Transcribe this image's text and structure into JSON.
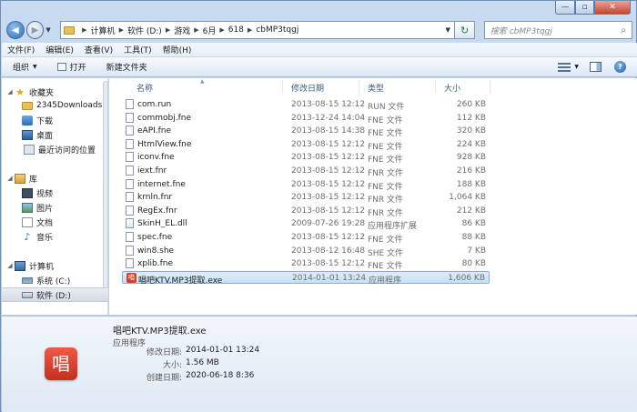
{
  "window": {
    "controls": {
      "minimize": "—",
      "maximize": "▫",
      "close": "✕"
    }
  },
  "nav": {
    "back_icon": "◀",
    "forward_icon": "▶",
    "recent_icon": "▼",
    "breadcrumb": [
      "计算机",
      "软件 (D:)",
      "游戏",
      "6月",
      "618",
      "cbMP3tqgj"
    ],
    "breadcrumb_sep": "▶",
    "dropdown_icon": "▼",
    "refresh_icon": "↻",
    "search_placeholder": "搜索 cbMP3tqgj",
    "search_icon": "⌕"
  },
  "menubar": [
    "文件(F)",
    "编辑(E)",
    "查看(V)",
    "工具(T)",
    "帮助(H)"
  ],
  "toolbar": {
    "organize": "组织",
    "organize_arrow": "▼",
    "open": "打开",
    "new_folder": "新建文件夹",
    "view_arrow": "▼",
    "help": "?"
  },
  "navpane": {
    "items": [
      {
        "label": "收藏夹",
        "icon": "star-icon",
        "glyph": "★",
        "level": 0,
        "expanded": true
      },
      {
        "label": "2345Downloads",
        "icon": "folder-icon",
        "level": 1
      },
      {
        "label": "下载",
        "icon": "download-folder-icon",
        "level": 1
      },
      {
        "label": "桌面",
        "icon": "desktop-icon",
        "level": 1
      },
      {
        "label": "最近访问的位置",
        "icon": "recent-places-icon",
        "level": 1
      },
      {
        "label": "库",
        "icon": "library-icon",
        "level": 0,
        "expanded": true
      },
      {
        "label": "视频",
        "icon": "video-library-icon",
        "level": 1
      },
      {
        "label": "图片",
        "icon": "pictures-library-icon",
        "level": 1
      },
      {
        "label": "文档",
        "icon": "documents-library-icon",
        "level": 1
      },
      {
        "label": "音乐",
        "icon": "music-library-icon",
        "glyph": "♪",
        "level": 1
      },
      {
        "label": "计算机",
        "icon": "computer-icon",
        "level": 0,
        "expanded": true
      },
      {
        "label": "系统 (C:)",
        "icon": "drive-c-icon",
        "level": 1
      },
      {
        "label": "软件 (D:)",
        "icon": "drive-d-icon",
        "level": 1,
        "selected": true
      }
    ],
    "expanded_glyph": "◢"
  },
  "filelist": {
    "columns": {
      "name": "名称",
      "date": "修改日期",
      "type": "类型",
      "size": "大小"
    },
    "sort_glyph": "▲",
    "rows": [
      {
        "name": "com.run",
        "date": "2013-08-15 12:12",
        "type": "RUN 文件",
        "size": "260 KB",
        "kind": "file"
      },
      {
        "name": "commobj.fne",
        "date": "2013-12-24 14:04",
        "type": "FNE 文件",
        "size": "112 KB",
        "kind": "file"
      },
      {
        "name": "eAPI.fne",
        "date": "2013-08-15 14:38",
        "type": "FNE 文件",
        "size": "320 KB",
        "kind": "file"
      },
      {
        "name": "HtmlView.fne",
        "date": "2013-08-15 12:12",
        "type": "FNE 文件",
        "size": "224 KB",
        "kind": "file"
      },
      {
        "name": "iconv.fne",
        "date": "2013-08-15 12:12",
        "type": "FNE 文件",
        "size": "928 KB",
        "kind": "file"
      },
      {
        "name": "iext.fnr",
        "date": "2013-08-15 12:12",
        "type": "FNR 文件",
        "size": "216 KB",
        "kind": "file"
      },
      {
        "name": "internet.fne",
        "date": "2013-08-15 12:12",
        "type": "FNE 文件",
        "size": "188 KB",
        "kind": "file"
      },
      {
        "name": "krnln.fnr",
        "date": "2013-08-15 12:12",
        "type": "FNR 文件",
        "size": "1,064 KB",
        "kind": "file"
      },
      {
        "name": "RegEx.fnr",
        "date": "2013-08-15 12:12",
        "type": "FNR 文件",
        "size": "212 KB",
        "kind": "file"
      },
      {
        "name": "SkinH_EL.dll",
        "date": "2009-07-26 19:28",
        "type": "应用程序扩展",
        "size": "86 KB",
        "kind": "dll"
      },
      {
        "name": "spec.fne",
        "date": "2013-08-15 12:12",
        "type": "FNE 文件",
        "size": "88 KB",
        "kind": "file"
      },
      {
        "name": "win8.she",
        "date": "2013-08-12 16:48",
        "type": "SHE 文件",
        "size": "7 KB",
        "kind": "file"
      },
      {
        "name": "xplib.fne",
        "date": "2013-08-15 12:12",
        "type": "FNE 文件",
        "size": "80 KB",
        "kind": "file"
      },
      {
        "name": "唱吧KTV.MP3提取.exe",
        "date": "2014-01-01 13:24",
        "type": "应用程序",
        "size": "1,606 KB",
        "kind": "app",
        "selected": true
      }
    ]
  },
  "details": {
    "app_glyph": "唱",
    "name": "唱吧KTV.MP3提取.exe",
    "type": "应用程序",
    "modified_label": "修改日期:",
    "modified": "2014-01-01 13:24",
    "size_label": "大小:",
    "size": "1.56 MB",
    "created_label": "创建日期:",
    "created": "2020-06-18 8:36"
  }
}
